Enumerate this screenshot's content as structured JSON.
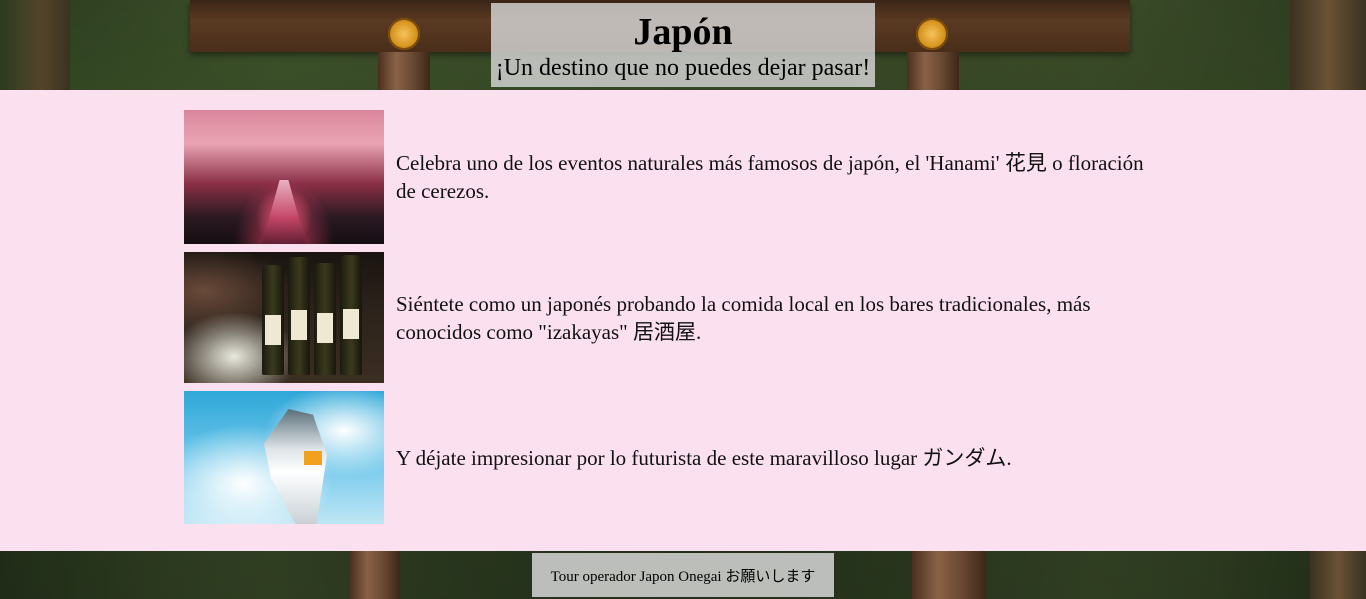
{
  "header": {
    "title": "Japón",
    "subtitle": "¡Un destino que no puedes dejar pasar!"
  },
  "features": [
    {
      "image": "cherry-blossom-canal-photo",
      "text": "Celebra uno de los eventos naturales más famosos de japón, el 'Hanami' 花見 o floración de cerezos."
    },
    {
      "image": "sake-bottles-izakaya-photo",
      "text": "Siéntete como un japonés probando la comida local en los bares tradicionales, más conocidos como \"izakayas\" 居酒屋."
    },
    {
      "image": "gundam-statue-photo",
      "text": "Y déjate impresionar por lo futurista de este maravilloso lugar ガンダム."
    }
  ],
  "footer": {
    "text": "Tour operador Japon Onegai お願いします"
  },
  "colors": {
    "panel_background": "#fbe0ef",
    "header_box": "#d7d7d7"
  }
}
